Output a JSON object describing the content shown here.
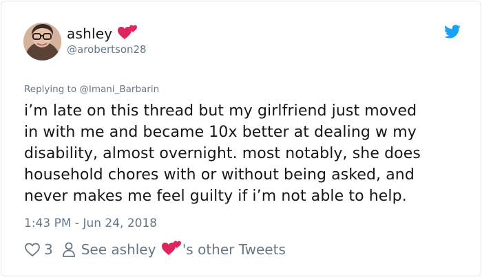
{
  "author": {
    "name": "ashley",
    "handle": "@arobertson28"
  },
  "reply": {
    "prefix": "Replying to ",
    "to_handle": "@Imani_Barbarin"
  },
  "tweet": {
    "text": "i’m late on this thread but my girlfriend just moved\nin with me and became 10x better at dealing w my\ndisability, almost overnight. most notably, she does\nhousehold chores with or without being asked, and\nnever makes me feel guilty if i’m not able to help."
  },
  "timestamp": "1:43 PM - Jun 24, 2018",
  "actions": {
    "like_count": "3",
    "see_prefix": "See ashley",
    "see_suffix": "'s other Tweets"
  },
  "colors": {
    "brand_blue": "#1da1f2",
    "heart_pink": "#e0245e",
    "muted": "#657786"
  },
  "icons": [
    "two-hearts-icon",
    "twitter-bird-icon",
    "heart-outline-icon",
    "person-icon"
  ]
}
